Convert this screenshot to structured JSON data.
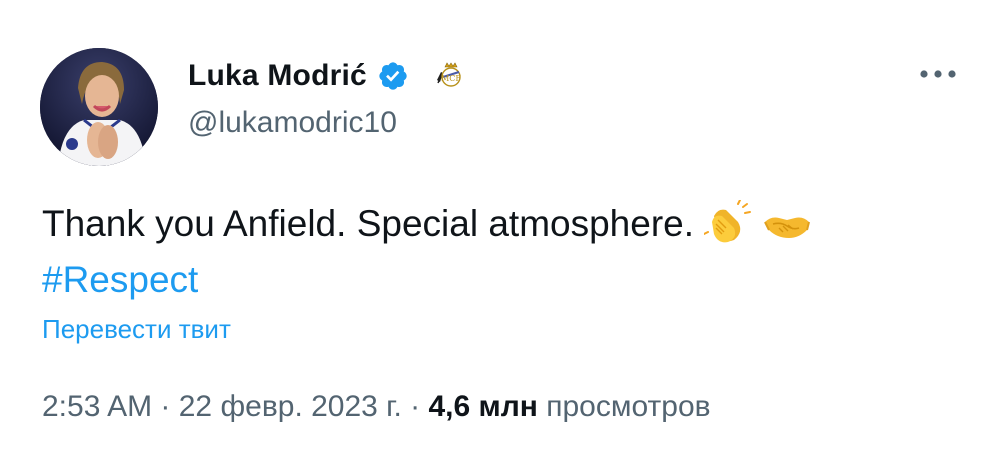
{
  "author": {
    "display_name": "Luka Modrić",
    "handle": "@lukamodric10",
    "verified": true,
    "avatar_icon": "profile-photo",
    "badge_icon": "real-madrid-crest-icon"
  },
  "menu": {
    "icon": "more-horizontal-icon"
  },
  "tweet": {
    "text": "Thank you Anfield. Special atmosphere.",
    "emojis": [
      "clapping-hands-emoji",
      "handshake-emoji"
    ],
    "hashtag": "#Respect",
    "translate_label": "Перевести твит"
  },
  "meta": {
    "time": "2:53 AM",
    "separator": " · ",
    "date": "22 февр. 2023 г.",
    "views_count": "4,6 млн",
    "views_label": "просмотров"
  },
  "colors": {
    "link": "#1d9bf0",
    "secondary_text": "#536471",
    "primary_text": "#0f1419",
    "verified_badge": "#1d9bf0"
  }
}
